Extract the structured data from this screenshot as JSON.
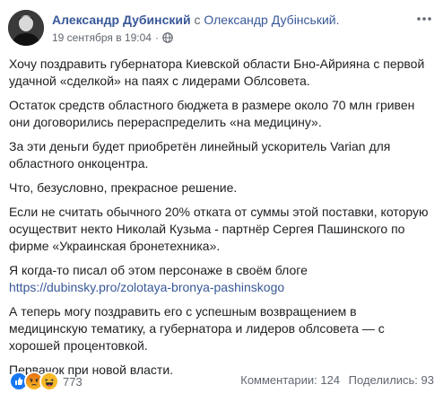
{
  "post": {
    "author": "Александр Дубинский",
    "with_word": "с",
    "tagged": "Олександр Дубінський.",
    "timestamp": "19 сентября в 19:04",
    "privacy_icon": "globe-icon",
    "more_icon": "more-options-icon",
    "paragraphs": [
      "Хочу поздравить губернатора Киевской области Бно-Айрияна с первой удачной «сделкой» на паях с лидерами Облсовета.",
      "Остаток средств областного бюджета в размере около 70 млн гривен они договорились перераспределить «на медицину».",
      "За эти деньги будет приобретён линейный ускоритель Varian для областного онкоцентра.",
      "Что, безусловно, прекрасное решение.",
      "Если не считать обычного 20% отката от суммы этой поставки, которую осуществит некто Николай Кузьма - партнёр Сергея Пашинского по фирме «Украинская бронетехника»."
    ],
    "blog_intro": "Я когда-то писал об этом персонаже в своём блоге",
    "blog_link": "https://dubinsky.pro/zolotaya-bronya-pashinskogo",
    "paragraphs_after": [
      "А теперь могу поздравить его с успешным возвращением в медицинскую тематику, а губернатора и лидеров облсовета — с хорошей процентовкой.",
      "Первачок при новой власти."
    ]
  },
  "footer": {
    "reaction_icons": [
      "like-icon",
      "angry-icon",
      "haha-icon"
    ],
    "reaction_count": "773",
    "comments": "Комментарии: 124",
    "shares": "Поделились: 93",
    "colors": {
      "like": "#1877f2",
      "angry": "#e9710f",
      "haha": "#f7b928"
    }
  }
}
